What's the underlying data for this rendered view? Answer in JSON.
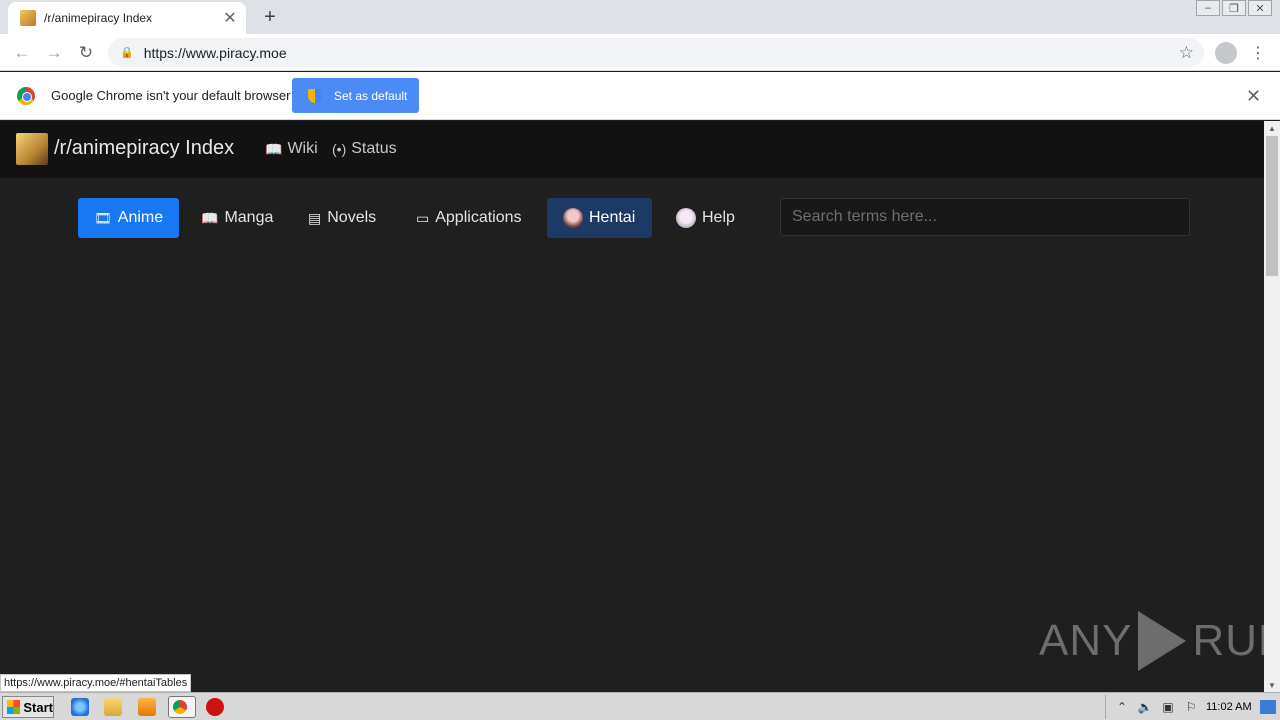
{
  "browser": {
    "tab_title": "/r/animepiracy Index",
    "url": "https://www.piracy.moe",
    "new_tab_icon": "plus-icon",
    "infobar_text": "Google Chrome isn't your default browser",
    "set_default_label": "Set as default",
    "status_url": "https://www.piracy.moe/#hentaiTables"
  },
  "site": {
    "brand": "/r/animepiracy Index",
    "nav": [
      {
        "label": "Wiki",
        "icon": "book-icon"
      },
      {
        "label": "Status",
        "icon": "broadcast-icon"
      }
    ],
    "tabs": [
      {
        "label": "Anime",
        "icon": "film-icon",
        "state": "active"
      },
      {
        "label": "Manga",
        "icon": "book-icon",
        "state": "normal"
      },
      {
        "label": "Novels",
        "icon": "document-icon",
        "state": "normal"
      },
      {
        "label": "Applications",
        "icon": "window-icon",
        "state": "normal"
      },
      {
        "label": "Hentai",
        "icon": "avatar-icon",
        "state": "hover"
      },
      {
        "label": "Help",
        "icon": "avatar-icon",
        "state": "normal"
      }
    ],
    "search_placeholder": "Search terms here...",
    "accent_color": "#1877f2",
    "hover_color": "#1c3a63"
  },
  "watermark": {
    "left": "ANY",
    "right": "RUN"
  },
  "taskbar": {
    "start_label": "Start",
    "clock": "11:02 AM"
  }
}
